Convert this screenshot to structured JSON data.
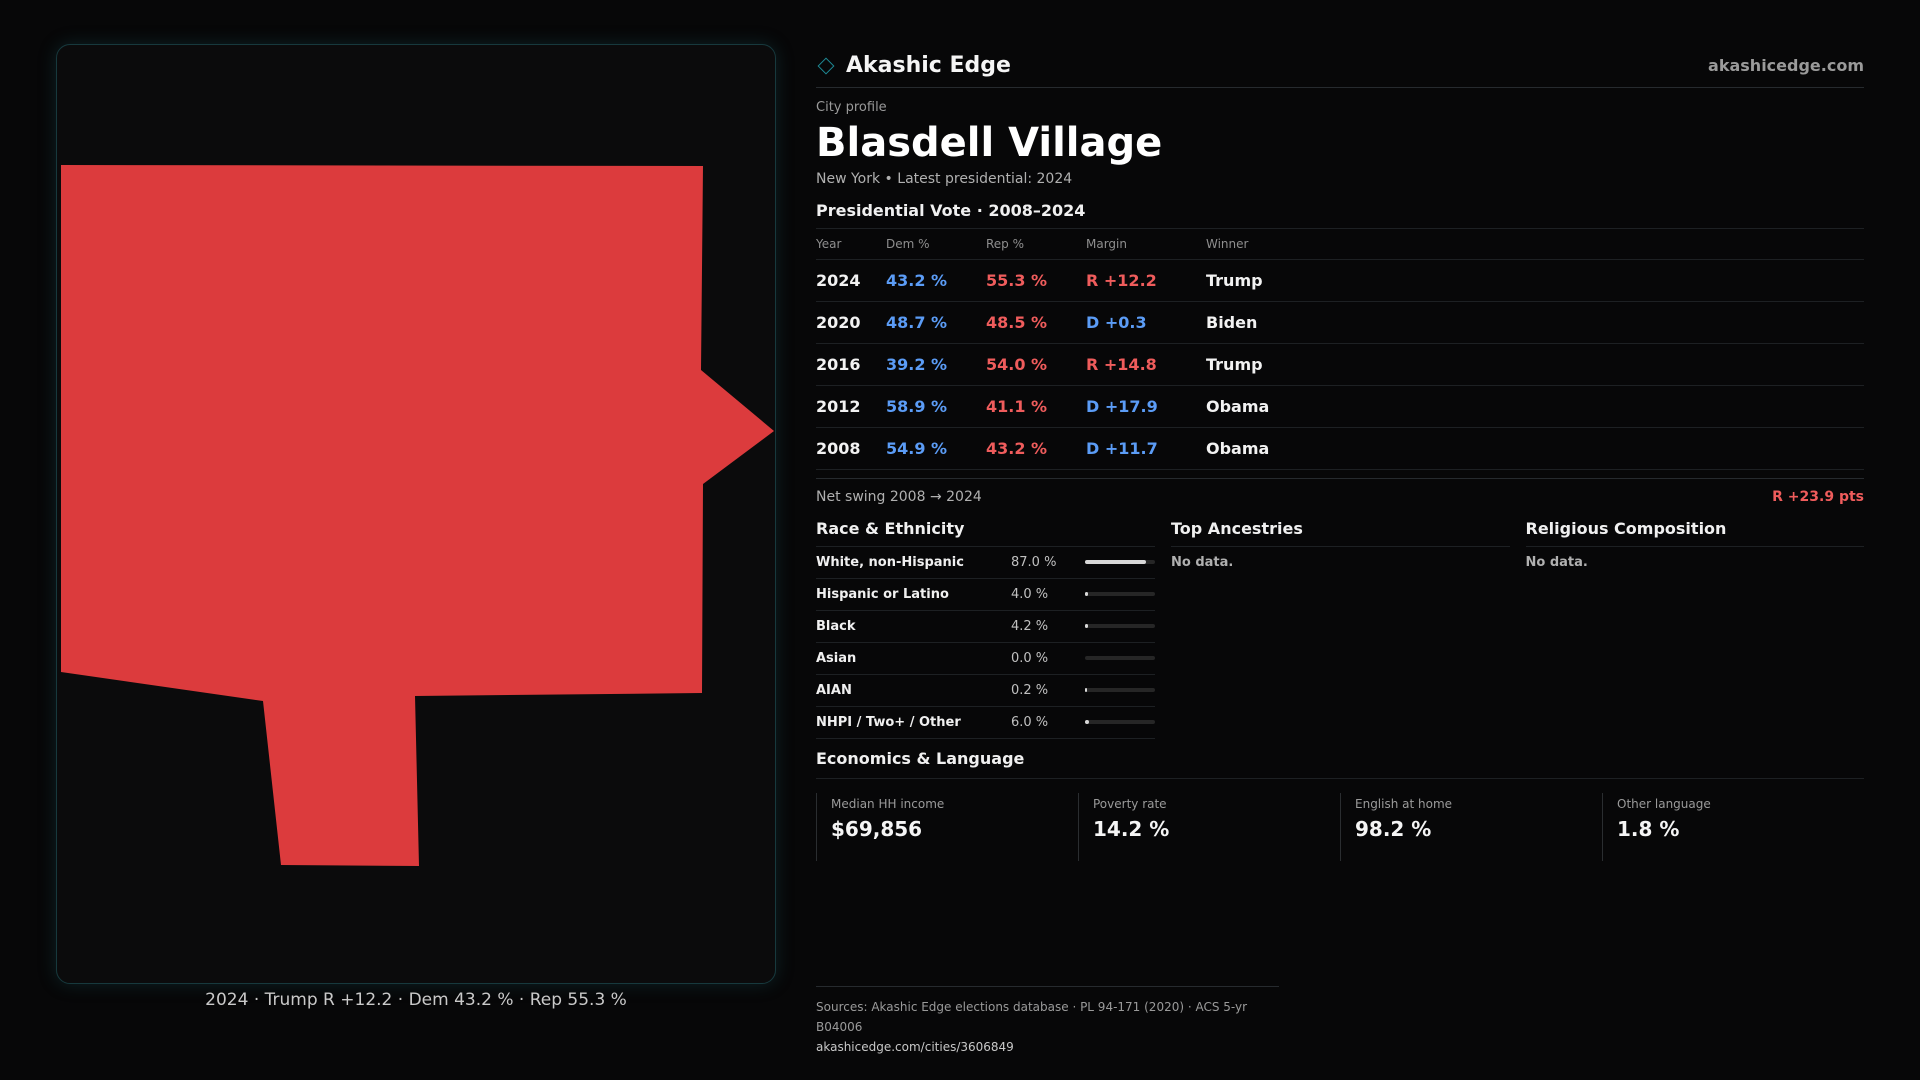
{
  "map": {
    "caption": "2024 · Trump  R +12.2 · Dem 43.2 % · Rep 55.3 %",
    "fill_color": "#dc3b3d",
    "border_color": "#17393d"
  },
  "header": {
    "brand": "Akashic Edge",
    "domain": "akashicedge.com"
  },
  "profile": {
    "eyebrow": "City profile",
    "title": "Blasdell Village",
    "subline": "New York  • Latest presidential: 2024"
  },
  "presidential": {
    "title": "Presidential Vote · 2008–2024",
    "columns": [
      "Year",
      "Dem %",
      "Rep %",
      "Margin",
      "Winner"
    ],
    "rows": [
      {
        "year": "2024",
        "dem": "43.2 %",
        "rep": "55.3 %",
        "margin": "R +12.2",
        "party": "R",
        "winner": "Trump"
      },
      {
        "year": "2020",
        "dem": "48.7 %",
        "rep": "48.5 %",
        "margin": "D +0.3",
        "party": "D",
        "winner": "Biden"
      },
      {
        "year": "2016",
        "dem": "39.2 %",
        "rep": "54.0 %",
        "margin": "R +14.8",
        "party": "R",
        "winner": "Trump"
      },
      {
        "year": "2012",
        "dem": "58.9 %",
        "rep": "41.1 %",
        "margin": "D +17.9",
        "party": "D",
        "winner": "Obama"
      },
      {
        "year": "2008",
        "dem": "54.9 %",
        "rep": "43.2 %",
        "margin": "D +11.7",
        "party": "D",
        "winner": "Obama"
      }
    ],
    "swing_label": "Net swing 2008 → 2024",
    "swing_value": "R +23.9 pts"
  },
  "race": {
    "title": "Race & Ethnicity",
    "rows": [
      {
        "label": "White, non-Hispanic",
        "pct": "87.0 %",
        "value": 87.0
      },
      {
        "label": "Hispanic or Latino",
        "pct": "4.0 %",
        "value": 4.0
      },
      {
        "label": "Black",
        "pct": "4.2 %",
        "value": 4.2
      },
      {
        "label": "Asian",
        "pct": "0.0 %",
        "value": 0.0
      },
      {
        "label": "AIAN",
        "pct": "0.2 %",
        "value": 0.2
      },
      {
        "label": "NHPI / Two+ / Other",
        "pct": "6.0 %",
        "value": 6.0
      }
    ]
  },
  "ancestries": {
    "title": "Top Ancestries",
    "empty": "No data."
  },
  "religion": {
    "title": "Religious Composition",
    "empty": "No data."
  },
  "economics": {
    "title": "Economics & Language",
    "cards": [
      {
        "label": "Median HH income",
        "value": "$69,856"
      },
      {
        "label": "Poverty rate",
        "value": "14.2 %"
      },
      {
        "label": "English at home",
        "value": "98.2 %"
      },
      {
        "label": "Other language",
        "value": "1.8 %"
      }
    ]
  },
  "footer": {
    "sources": "Sources: Akashic Edge elections database · PL 94-171 (2020) · ACS 5-yr B04006",
    "url": "akashicedge.com/cities/3606849"
  },
  "colors": {
    "dem": "#5b9cf6",
    "rep": "#ef5c5c",
    "accent": "#1e8a96"
  }
}
